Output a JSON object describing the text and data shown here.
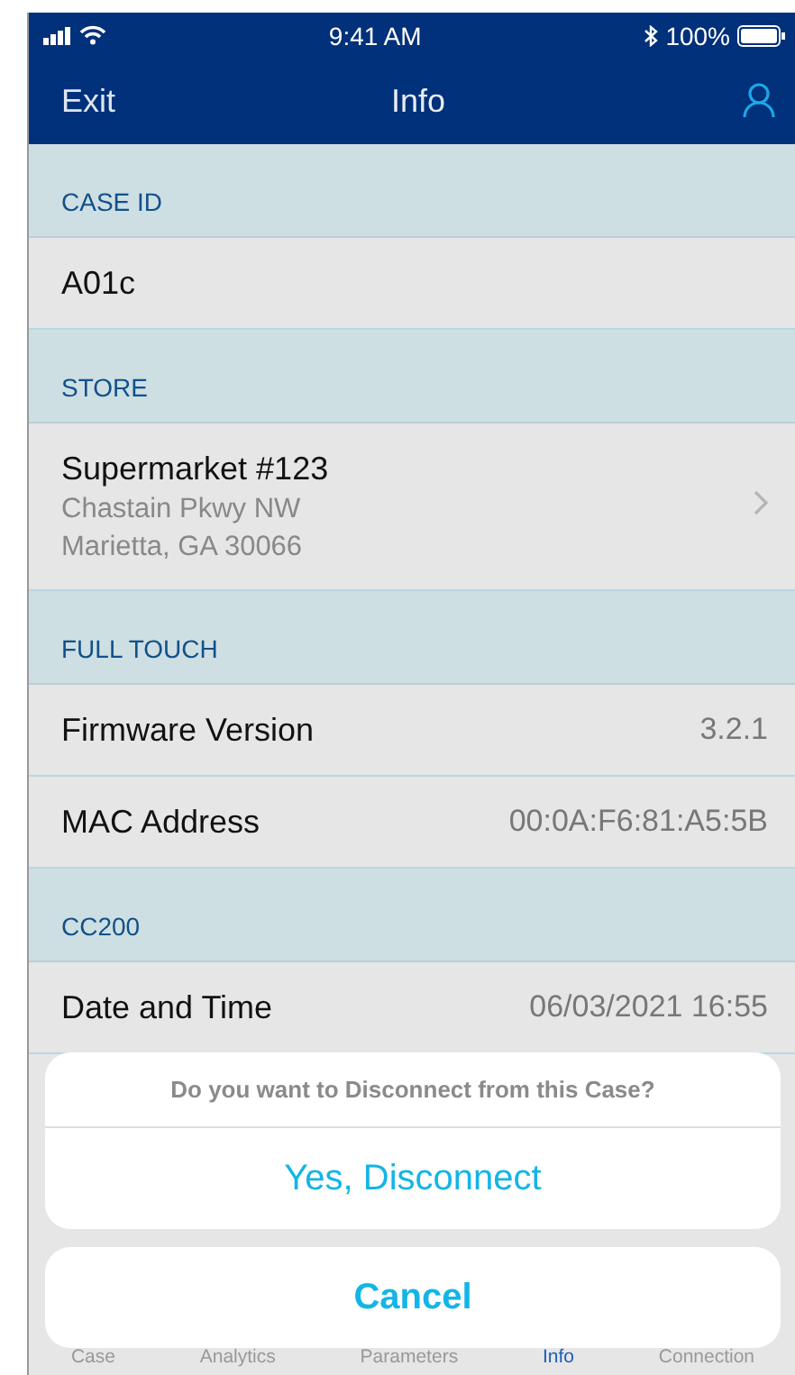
{
  "status_bar": {
    "time": "9:41 AM",
    "battery": "100%"
  },
  "nav": {
    "left": "Exit",
    "title": "Info"
  },
  "sections": [
    {
      "header": "CASE ID",
      "rows": [
        {
          "kind": "plain",
          "label": "A01c"
        }
      ]
    },
    {
      "header": "STORE",
      "rows": [
        {
          "kind": "link",
          "label": "Supermarket #123",
          "lines": [
            "Chastain Pkwy NW",
            "Marietta, GA 30066"
          ]
        }
      ]
    },
    {
      "header": "FULL TOUCH",
      "rows": [
        {
          "kind": "value",
          "label": "Firmware Version",
          "value": "3.2.1"
        },
        {
          "kind": "value",
          "label": "MAC Address",
          "value": "00:0A:F6:81:A5:5B"
        }
      ]
    },
    {
      "header": "CC200",
      "rows": [
        {
          "kind": "value",
          "label": "Date and Time",
          "value": "06/03/2021 16:55"
        }
      ]
    }
  ],
  "tab_bar": [
    {
      "label": "Case",
      "selected": false
    },
    {
      "label": "Analytics",
      "selected": false
    },
    {
      "label": "Parameters",
      "selected": false
    },
    {
      "label": "Info",
      "selected": true
    },
    {
      "label": "Connection",
      "selected": false
    }
  ],
  "action_sheet": {
    "message": "Do you want to Disconnect from this Case?",
    "actions": [
      "Yes, Disconnect"
    ],
    "cancel": "Cancel"
  }
}
